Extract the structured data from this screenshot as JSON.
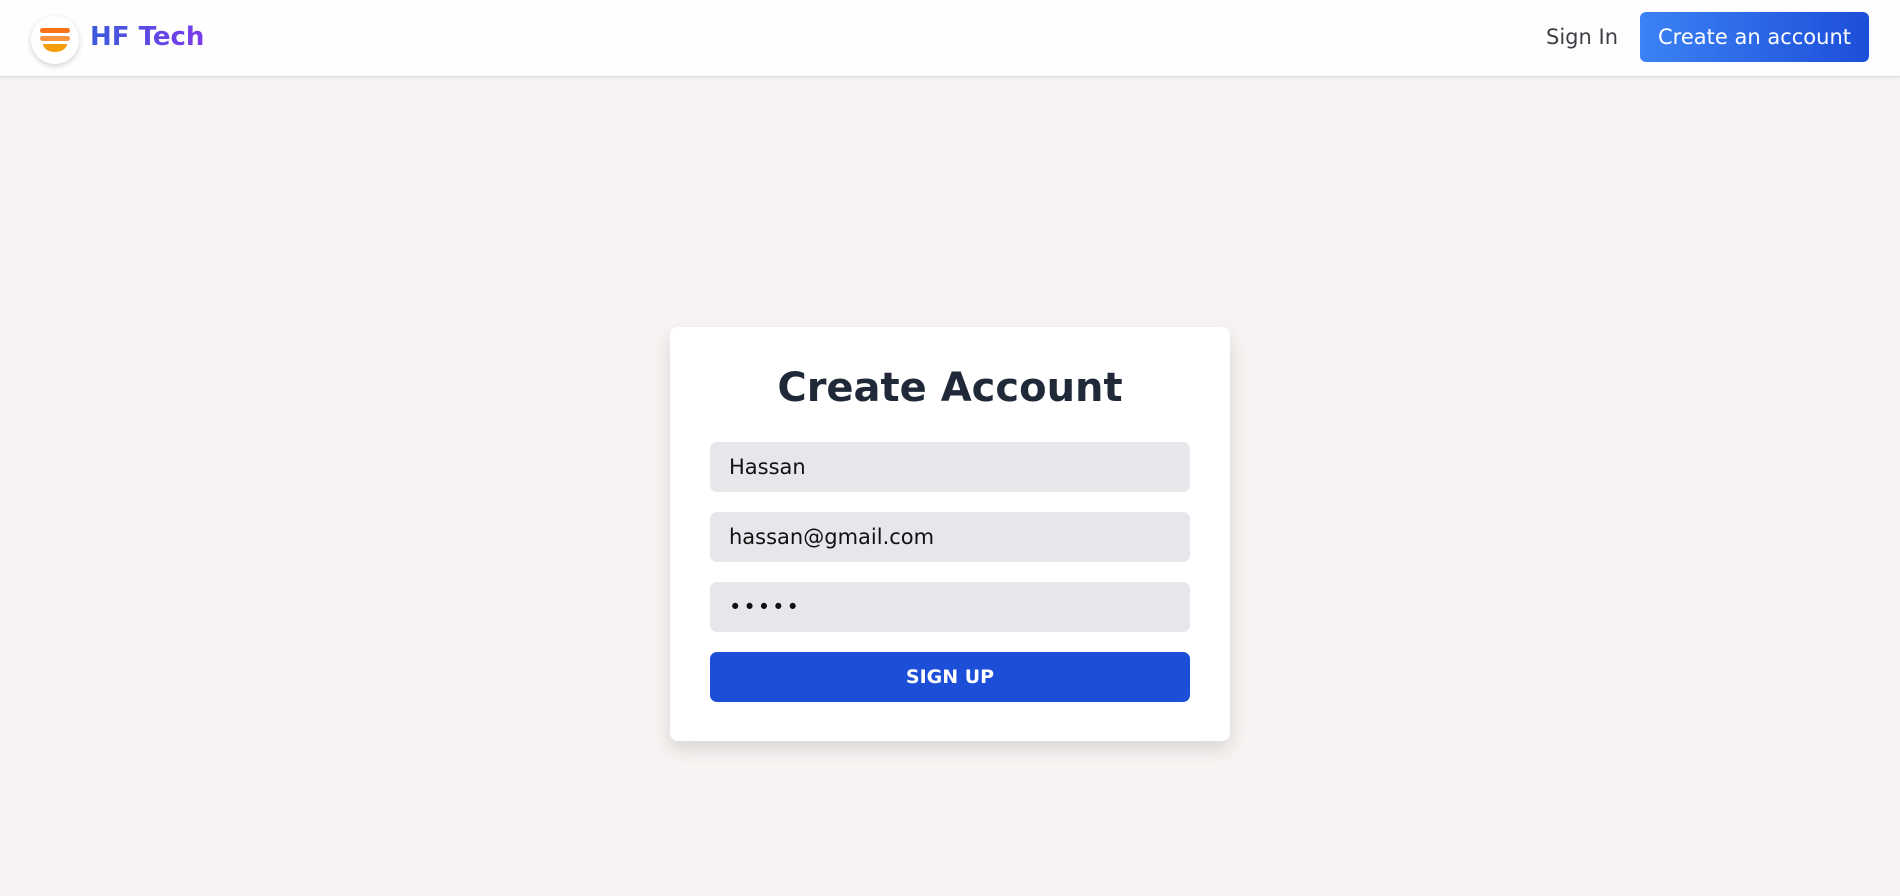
{
  "navbar": {
    "brand": "HF Tech",
    "logo_icon": "stacked-stripes-logo-icon",
    "sign_in_label": "Sign In",
    "create_account_label": "Create an account"
  },
  "form": {
    "title": "Create Account",
    "name_value": "Hassan",
    "email_value": "hassan@gmail.com",
    "password_value": "•••••",
    "submit_label": "SIGN UP"
  },
  "colors": {
    "page_background": "#f7f3f2",
    "brand_gradient_start": "#3b5bdb",
    "brand_gradient_end": "#7c3aed",
    "primary_button": "#1d4ed8",
    "input_background": "#e5e7eb",
    "logo_orange": "#f97316"
  }
}
